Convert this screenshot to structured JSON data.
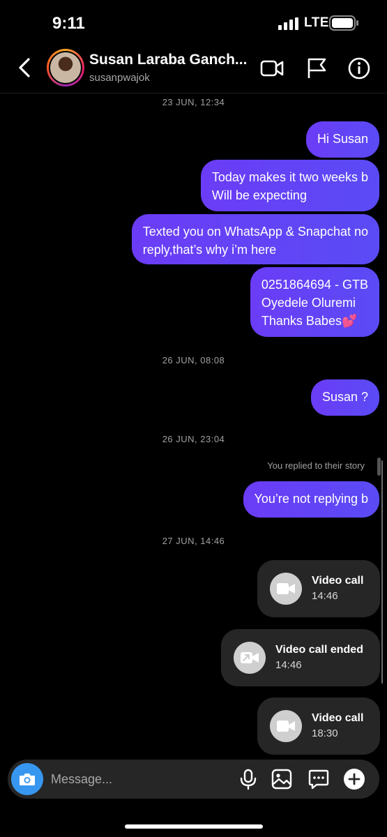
{
  "status_bar": {
    "time": "9:11",
    "network": "LTE"
  },
  "header": {
    "contact_name": "Susan Laraba Ganch...",
    "username": "susanpwajok",
    "icons": [
      "back-icon",
      "video-call-icon",
      "flag-icon",
      "info-icon"
    ]
  },
  "messages": {
    "ts1": "23 JUN, 12:34",
    "m1": "Hi Susan",
    "m2_line1": "Today makes it two weeks b",
    "m2_line2": "Will be expecting",
    "m3_line1": "Texted you on WhatsApp & Snapchat no",
    "m3_line2": "reply,that’s why i’m here",
    "m4_line1": "0251864694 - GTB",
    "m4_line2": "Oyedele Oluremi",
    "m4_line3": "Thanks Babes💕",
    "ts2": "26 JUN, 08:08",
    "m5": "Susan ?",
    "ts3": "26 JUN, 23:04",
    "reply_note": "You replied to their story",
    "m6": "You’re not replying b",
    "ts4": "27 JUN, 14:46"
  },
  "calls": [
    {
      "title": "Video call",
      "time": "14:46",
      "icon": "video-camera-icon"
    },
    {
      "title": "Video call ended",
      "time": "14:46",
      "icon": "video-call-ended-icon"
    },
    {
      "title": "Video call",
      "time": "18:30",
      "icon": "video-camera-icon"
    }
  ],
  "composer": {
    "placeholder": "Message...",
    "icons": [
      "camera-icon",
      "microphone-icon",
      "gallery-icon",
      "sticker-icon",
      "plus-icon"
    ]
  },
  "colors": {
    "bubble": "#6b3cf6",
    "background": "#000000",
    "card": "#262626",
    "camera_button": "#3797f0"
  }
}
